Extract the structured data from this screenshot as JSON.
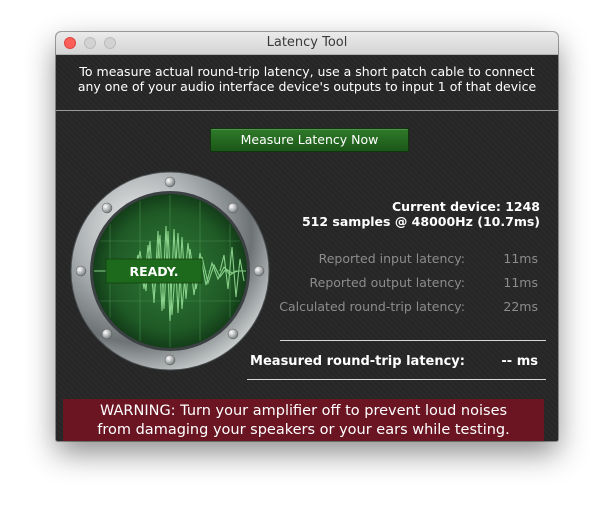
{
  "window": {
    "title": "Latency Tool"
  },
  "intro": {
    "line1": "To measure actual round-trip latency, use a short patch cable to connect",
    "line2": "any one of your audio interface device's outputs to input 1 of that device"
  },
  "measure_button": {
    "label": "Measure Latency Now"
  },
  "scope": {
    "status": "READY."
  },
  "device": {
    "current": "Current device: 1248",
    "rate": "512 samples @ 48000Hz (10.7ms)"
  },
  "latency_rows": [
    {
      "label": "Reported input latency:",
      "value": "11ms"
    },
    {
      "label": "Reported output latency:",
      "value": "11ms"
    },
    {
      "label": "Calculated round-trip latency:",
      "value": "22ms"
    }
  ],
  "measured": {
    "label": "Measured round-trip latency:",
    "value": "-- ms"
  },
  "warning": {
    "line1": "WARNING: Turn your amplifier off to prevent loud noises",
    "line2": "from damaging your speakers or your ears while testing."
  },
  "colors": {
    "panel": "#262626",
    "accent_green": "#2a6d25",
    "warning_bg": "#6b1523",
    "close_button": "#fc5f57"
  }
}
